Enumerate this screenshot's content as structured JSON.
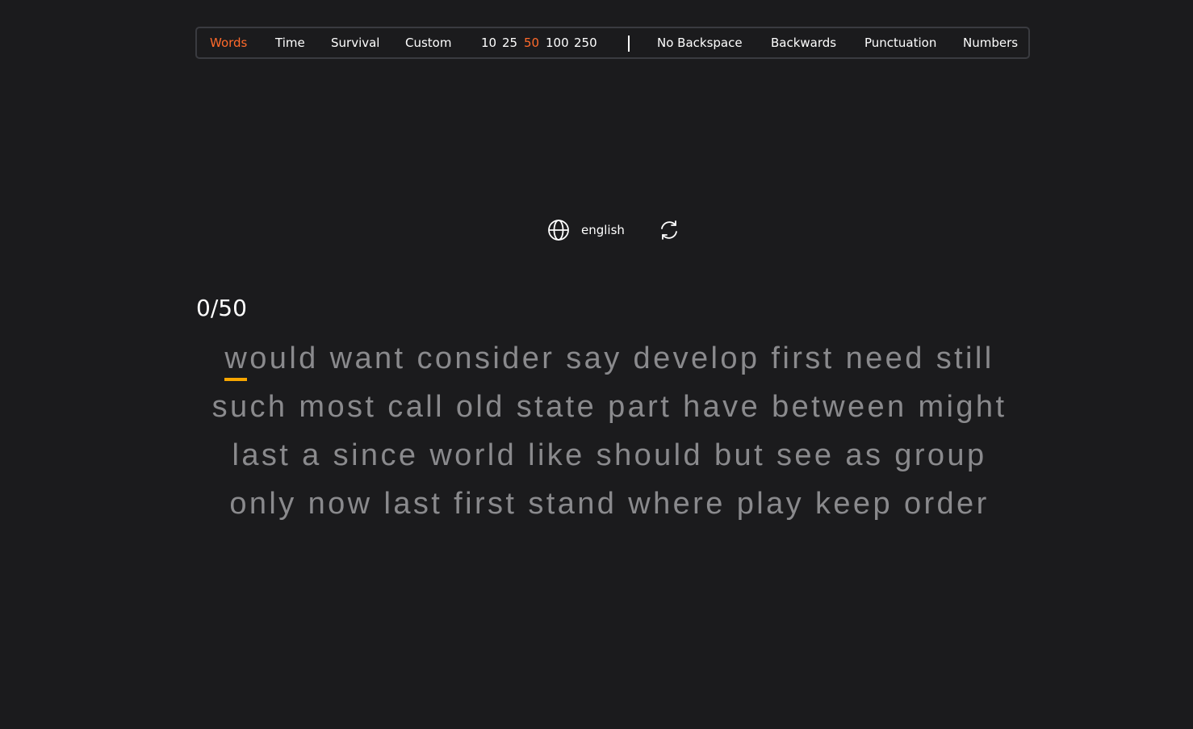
{
  "toolbar": {
    "modes": [
      "Words",
      "Time",
      "Survival",
      "Custom"
    ],
    "active_mode": "Words",
    "counts": [
      "10",
      "25",
      "50",
      "100",
      "250"
    ],
    "active_count": "50",
    "options": [
      "No Backspace",
      "Backwards",
      "Punctuation",
      "Numbers"
    ]
  },
  "language": {
    "label": "english",
    "icon": "globe-icon",
    "refresh_icon": "refresh-icon"
  },
  "progress": {
    "counter": "0/50"
  },
  "test": {
    "first_letter": "w",
    "lines": [
      "would want consider say develop first need still",
      "such most call old state part have between might",
      "last a since world like should but see as group",
      "only now last first stand where play keep order"
    ]
  },
  "colors": {
    "background": "#1b1b1d",
    "accent": "#ff6a2b",
    "cursor": "#f7a600",
    "untyped_text": "#8a8a8d",
    "border": "#3a3b40"
  }
}
